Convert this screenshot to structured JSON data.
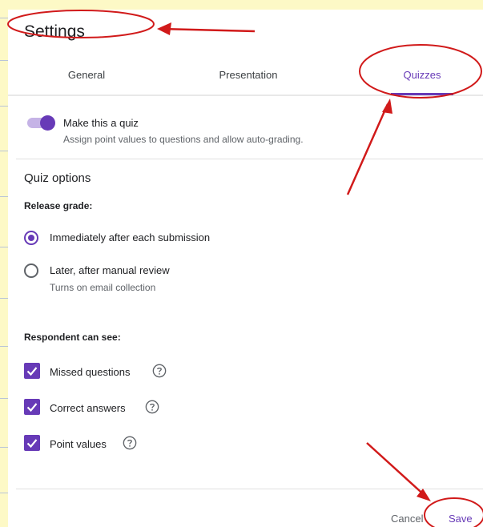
{
  "dialog": {
    "title": "Settings"
  },
  "tabs": [
    {
      "label": "General",
      "active": false
    },
    {
      "label": "Presentation",
      "active": false
    },
    {
      "label": "Quizzes",
      "active": true
    }
  ],
  "quiz_toggle": {
    "label": "Make this a quiz",
    "description": "Assign point values to questions and allow auto-grading.",
    "on": true
  },
  "quiz_options": {
    "title": "Quiz options",
    "release_grade": {
      "label": "Release grade:",
      "options": [
        {
          "label": "Immediately after each submission",
          "selected": true
        },
        {
          "label": "Later, after manual review",
          "sublabel": "Turns on email collection",
          "selected": false
        }
      ]
    },
    "respondent": {
      "label": "Respondent can see:",
      "items": [
        {
          "label": "Missed questions",
          "checked": true
        },
        {
          "label": "Correct answers",
          "checked": true
        },
        {
          "label": "Point values",
          "checked": true
        }
      ]
    }
  },
  "footer": {
    "cancel_label": "Cancel",
    "save_label": "Save"
  },
  "colors": {
    "accent": "#673ab7",
    "annotation": "#d11a1a",
    "background": "#fdf9c6"
  }
}
